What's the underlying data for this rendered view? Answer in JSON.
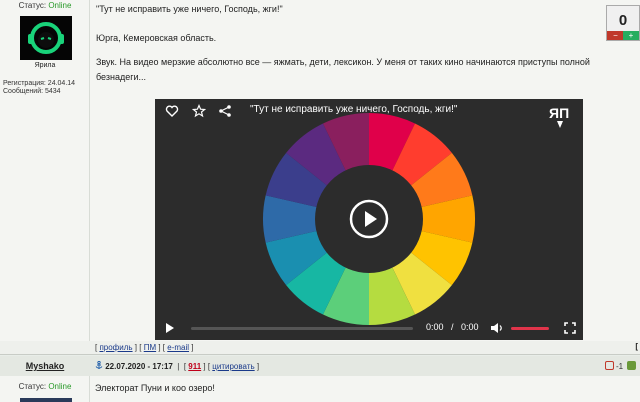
{
  "post": {
    "status_label": "Статус:",
    "status_value": "Online",
    "nick": "Ярила",
    "reg_label": "Регистрация: 24.04.14",
    "msgs_label": "Сообщений: 5434",
    "title": "\"Тут не исправить уже ничего, Господь, жги!\"",
    "location": "Юрга, Кемеровская область.",
    "body": "Звук. На видео мерзкие абсолютно все — яжмать, дети, лексикон. У меня от таких кино начинаются приступы полной безнадеги...",
    "rating": "0",
    "rating_minus": "−",
    "rating_plus": "+"
  },
  "player": {
    "title": "\"Тут не исправить уже ничего, Господь, жги!\"",
    "time_current": "0:00",
    "time_sep": "/",
    "time_total": "0:00",
    "logo": "ЯП",
    "wheel_colors": [
      "#e0004a",
      "#ff3d2e",
      "#ff7a1a",
      "#ffa500",
      "#ffc300",
      "#f0e040",
      "#b5dc40",
      "#5ccf7a",
      "#17b7a3",
      "#1a8fb0",
      "#2e6aa8",
      "#3b3e8c",
      "#5b2a80",
      "#8a1f5e"
    ],
    "icons": [
      "heart-icon",
      "star-icon",
      "share-icon",
      "play-icon",
      "volume-icon",
      "fullscreen-icon"
    ]
  },
  "footer": {
    "open": "[ ",
    "profile": "профиль",
    "sep1": " ] [ ",
    "pm": "ПМ",
    "sep2": " ] [ ",
    "email": "e-mail",
    "close": " ]",
    "right_edge": "["
  },
  "next_post": {
    "author": "Myshako",
    "date": "22.07.2020 - 17:17",
    "num_open": "[ ",
    "num": "911",
    "num_close": " ] [ ",
    "quote": "цитировать",
    "quote_close": " ]",
    "status_label": "Статус:",
    "status_value": "Online",
    "text": "Электорат Пуни и коо озеро!",
    "vote_value": "-1"
  }
}
